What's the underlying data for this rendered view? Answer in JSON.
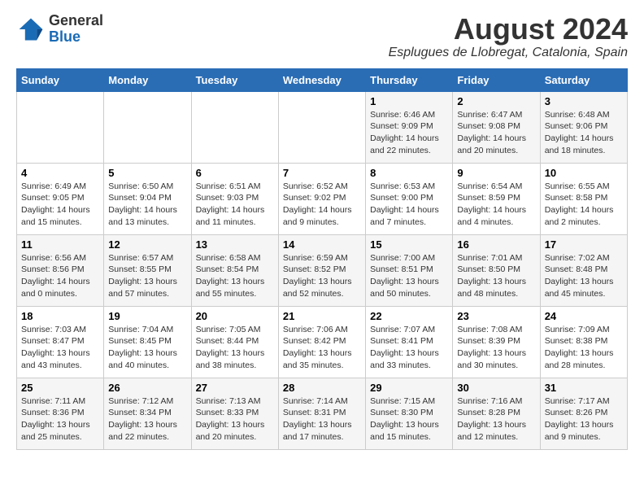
{
  "logo": {
    "general": "General",
    "blue": "Blue"
  },
  "title": {
    "month_year": "August 2024",
    "location": "Esplugues de Llobregat, Catalonia, Spain"
  },
  "headers": [
    "Sunday",
    "Monday",
    "Tuesday",
    "Wednesday",
    "Thursday",
    "Friday",
    "Saturday"
  ],
  "weeks": [
    [
      {
        "day": "",
        "info": ""
      },
      {
        "day": "",
        "info": ""
      },
      {
        "day": "",
        "info": ""
      },
      {
        "day": "",
        "info": ""
      },
      {
        "day": "1",
        "info": "Sunrise: 6:46 AM\nSunset: 9:09 PM\nDaylight: 14 hours\nand 22 minutes."
      },
      {
        "day": "2",
        "info": "Sunrise: 6:47 AM\nSunset: 9:08 PM\nDaylight: 14 hours\nand 20 minutes."
      },
      {
        "day": "3",
        "info": "Sunrise: 6:48 AM\nSunset: 9:06 PM\nDaylight: 14 hours\nand 18 minutes."
      }
    ],
    [
      {
        "day": "4",
        "info": "Sunrise: 6:49 AM\nSunset: 9:05 PM\nDaylight: 14 hours\nand 15 minutes."
      },
      {
        "day": "5",
        "info": "Sunrise: 6:50 AM\nSunset: 9:04 PM\nDaylight: 14 hours\nand 13 minutes."
      },
      {
        "day": "6",
        "info": "Sunrise: 6:51 AM\nSunset: 9:03 PM\nDaylight: 14 hours\nand 11 minutes."
      },
      {
        "day": "7",
        "info": "Sunrise: 6:52 AM\nSunset: 9:02 PM\nDaylight: 14 hours\nand 9 minutes."
      },
      {
        "day": "8",
        "info": "Sunrise: 6:53 AM\nSunset: 9:00 PM\nDaylight: 14 hours\nand 7 minutes."
      },
      {
        "day": "9",
        "info": "Sunrise: 6:54 AM\nSunset: 8:59 PM\nDaylight: 14 hours\nand 4 minutes."
      },
      {
        "day": "10",
        "info": "Sunrise: 6:55 AM\nSunset: 8:58 PM\nDaylight: 14 hours\nand 2 minutes."
      }
    ],
    [
      {
        "day": "11",
        "info": "Sunrise: 6:56 AM\nSunset: 8:56 PM\nDaylight: 14 hours\nand 0 minutes."
      },
      {
        "day": "12",
        "info": "Sunrise: 6:57 AM\nSunset: 8:55 PM\nDaylight: 13 hours\nand 57 minutes."
      },
      {
        "day": "13",
        "info": "Sunrise: 6:58 AM\nSunset: 8:54 PM\nDaylight: 13 hours\nand 55 minutes."
      },
      {
        "day": "14",
        "info": "Sunrise: 6:59 AM\nSunset: 8:52 PM\nDaylight: 13 hours\nand 52 minutes."
      },
      {
        "day": "15",
        "info": "Sunrise: 7:00 AM\nSunset: 8:51 PM\nDaylight: 13 hours\nand 50 minutes."
      },
      {
        "day": "16",
        "info": "Sunrise: 7:01 AM\nSunset: 8:50 PM\nDaylight: 13 hours\nand 48 minutes."
      },
      {
        "day": "17",
        "info": "Sunrise: 7:02 AM\nSunset: 8:48 PM\nDaylight: 13 hours\nand 45 minutes."
      }
    ],
    [
      {
        "day": "18",
        "info": "Sunrise: 7:03 AM\nSunset: 8:47 PM\nDaylight: 13 hours\nand 43 minutes."
      },
      {
        "day": "19",
        "info": "Sunrise: 7:04 AM\nSunset: 8:45 PM\nDaylight: 13 hours\nand 40 minutes."
      },
      {
        "day": "20",
        "info": "Sunrise: 7:05 AM\nSunset: 8:44 PM\nDaylight: 13 hours\nand 38 minutes."
      },
      {
        "day": "21",
        "info": "Sunrise: 7:06 AM\nSunset: 8:42 PM\nDaylight: 13 hours\nand 35 minutes."
      },
      {
        "day": "22",
        "info": "Sunrise: 7:07 AM\nSunset: 8:41 PM\nDaylight: 13 hours\nand 33 minutes."
      },
      {
        "day": "23",
        "info": "Sunrise: 7:08 AM\nSunset: 8:39 PM\nDaylight: 13 hours\nand 30 minutes."
      },
      {
        "day": "24",
        "info": "Sunrise: 7:09 AM\nSunset: 8:38 PM\nDaylight: 13 hours\nand 28 minutes."
      }
    ],
    [
      {
        "day": "25",
        "info": "Sunrise: 7:11 AM\nSunset: 8:36 PM\nDaylight: 13 hours\nand 25 minutes."
      },
      {
        "day": "26",
        "info": "Sunrise: 7:12 AM\nSunset: 8:34 PM\nDaylight: 13 hours\nand 22 minutes."
      },
      {
        "day": "27",
        "info": "Sunrise: 7:13 AM\nSunset: 8:33 PM\nDaylight: 13 hours\nand 20 minutes."
      },
      {
        "day": "28",
        "info": "Sunrise: 7:14 AM\nSunset: 8:31 PM\nDaylight: 13 hours\nand 17 minutes."
      },
      {
        "day": "29",
        "info": "Sunrise: 7:15 AM\nSunset: 8:30 PM\nDaylight: 13 hours\nand 15 minutes."
      },
      {
        "day": "30",
        "info": "Sunrise: 7:16 AM\nSunset: 8:28 PM\nDaylight: 13 hours\nand 12 minutes."
      },
      {
        "day": "31",
        "info": "Sunrise: 7:17 AM\nSunset: 8:26 PM\nDaylight: 13 hours\nand 9 minutes."
      }
    ]
  ]
}
